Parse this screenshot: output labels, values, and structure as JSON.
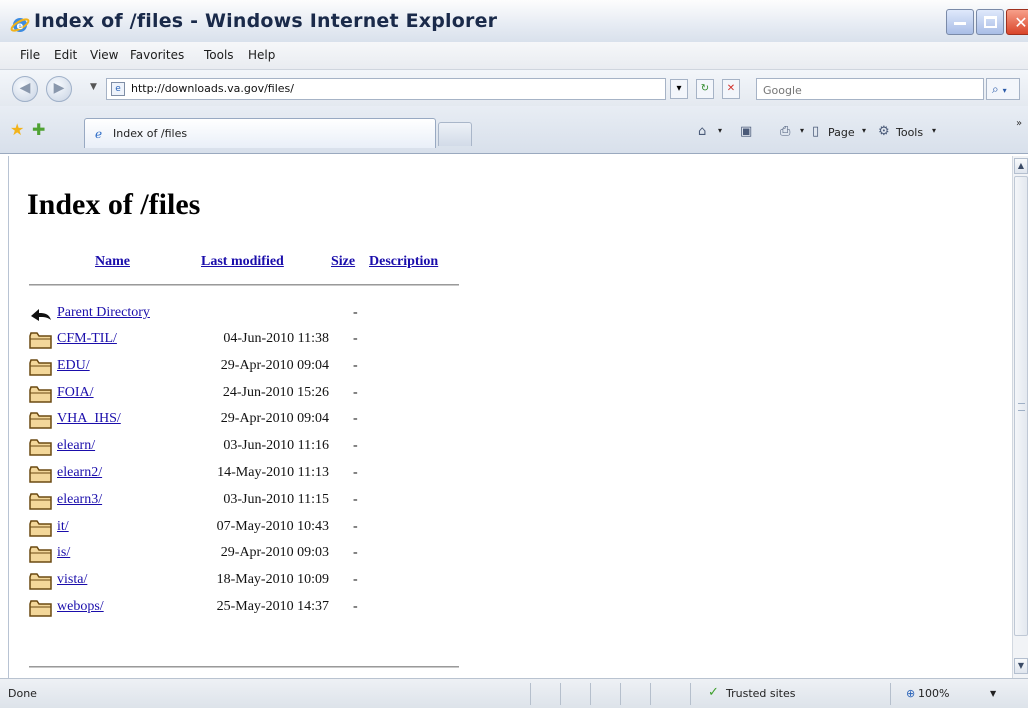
{
  "window": {
    "title": "Index of /files - Windows Internet Explorer"
  },
  "menu": [
    "File",
    "Edit",
    "View",
    "Favorites",
    "Tools",
    "Help"
  ],
  "address": {
    "url": "http://downloads.va.gov/files/",
    "search_placeholder": "Google"
  },
  "tab": {
    "label": "Index of /files"
  },
  "commands": {
    "page": "Page",
    "tools": "Tools"
  },
  "page": {
    "heading": "Index of /files",
    "columns": {
      "name": "Name",
      "modified": "Last modified",
      "size": "Size",
      "description": "Description"
    },
    "parent": {
      "name": "Parent Directory",
      "size": "-"
    },
    "entries": [
      {
        "name": "CFM-TIL/",
        "modified": "04-Jun-2010 11:38",
        "size": "-"
      },
      {
        "name": "EDU/",
        "modified": "29-Apr-2010 09:04",
        "size": "-"
      },
      {
        "name": "FOIA/",
        "modified": "24-Jun-2010 15:26",
        "size": "-"
      },
      {
        "name": "VHA_IHS/",
        "modified": "29-Apr-2010 09:04",
        "size": "-"
      },
      {
        "name": "elearn/",
        "modified": "03-Jun-2010 11:16",
        "size": "-"
      },
      {
        "name": "elearn2/",
        "modified": "14-May-2010 11:13",
        "size": "-"
      },
      {
        "name": "elearn3/",
        "modified": "03-Jun-2010 11:15",
        "size": "-"
      },
      {
        "name": "it/",
        "modified": "07-May-2010 10:43",
        "size": "-"
      },
      {
        "name": "is/",
        "modified": "29-Apr-2010 09:03",
        "size": "-"
      },
      {
        "name": "vista/",
        "modified": "18-May-2010 10:09",
        "size": "-"
      },
      {
        "name": "webops/",
        "modified": "25-May-2010 14:37",
        "size": "-"
      }
    ]
  },
  "status": {
    "text": "Done",
    "zone": "Trusted sites",
    "zoom": "100%"
  },
  "colors": {
    "link": "#1a0dab",
    "folder_fill": "#f3d79a",
    "folder_stroke": "#6b4a12"
  },
  "icons": {
    "title": "ie-logo-icon",
    "favorites": "star-icon",
    "add_favorite": "add-favorite-icon",
    "parent": "back-arrow-icon",
    "folder": "folder-icon",
    "trusted": "checkmark-icon",
    "zoom": "magnifier-icon"
  }
}
